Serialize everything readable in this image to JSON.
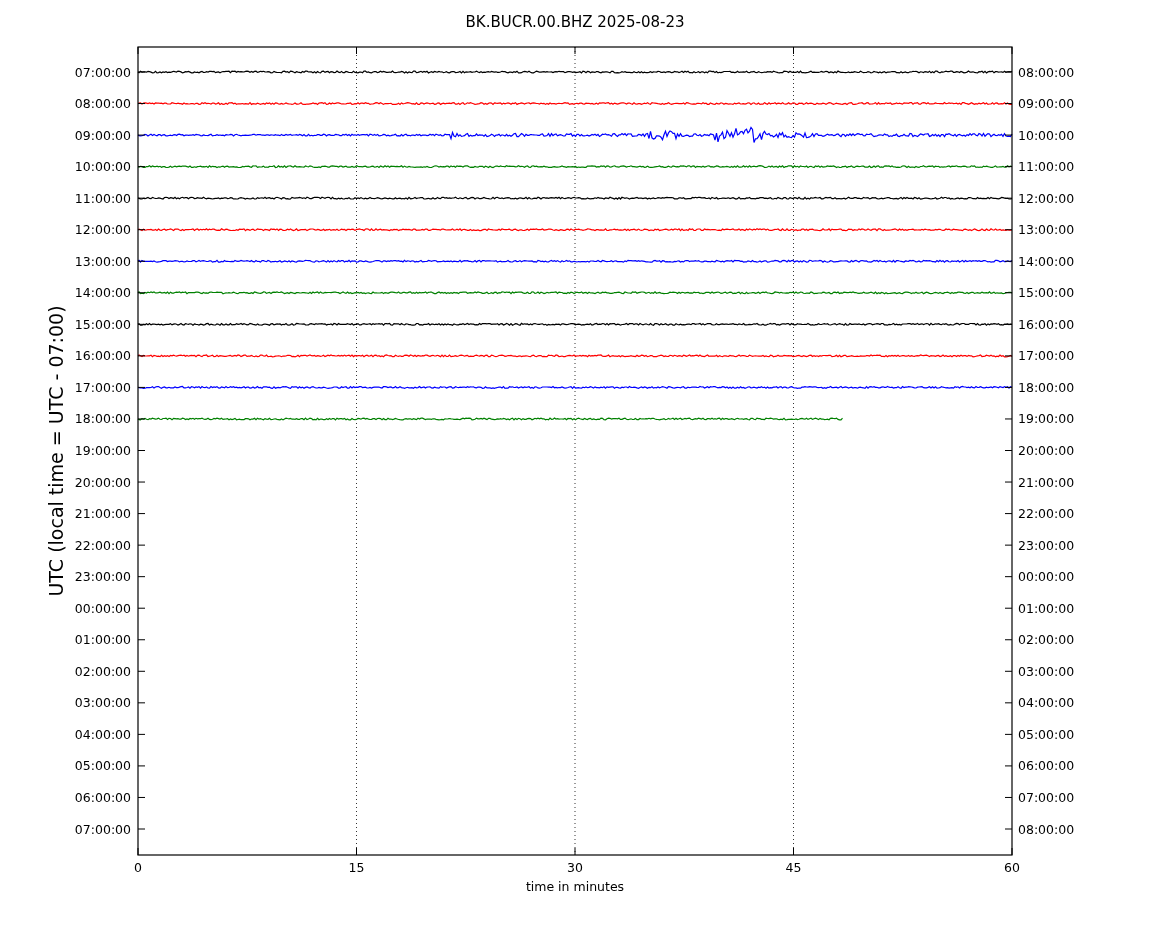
{
  "title": "BK.BUCR.00.BHZ 2025-08-23",
  "chart": {
    "ylabel": "UTC (local time = UTC - 07:00)",
    "xlabel": "time in minutes",
    "xticks": [
      "0",
      "15",
      "30",
      "45",
      "60"
    ],
    "left_labels": [
      "07:00:00",
      "08:00:00",
      "09:00:00",
      "10:00:00",
      "11:00:00",
      "12:00:00",
      "13:00:00",
      "14:00:00",
      "15:00:00",
      "16:00:00",
      "17:00:00",
      "18:00:00",
      "19:00:00",
      "20:00:00",
      "21:00:00",
      "22:00:00",
      "23:00:00",
      "00:00:00",
      "01:00:00",
      "02:00:00",
      "03:00:00",
      "04:00:00",
      "05:00:00",
      "06:00:00",
      "07:00:00"
    ],
    "right_labels": [
      "08:00:00",
      "09:00:00",
      "10:00:00",
      "11:00:00",
      "12:00:00",
      "13:00:00",
      "14:00:00",
      "15:00:00",
      "16:00:00",
      "17:00:00",
      "18:00:00",
      "19:00:00",
      "20:00:00",
      "21:00:00",
      "22:00:00",
      "23:00:00",
      "00:00:00",
      "01:00:00",
      "02:00:00",
      "03:00:00",
      "04:00:00",
      "05:00:00",
      "06:00:00",
      "07:00:00",
      "08:00:00"
    ],
    "traces": [
      {
        "kind": "quiet",
        "color": "#000000",
        "level": 1
      },
      {
        "kind": "quiet",
        "color": "#ff0000",
        "level": 1
      },
      {
        "kind": "event",
        "color": "#0000ff",
        "level": 1
      },
      {
        "kind": "quiet",
        "color": "#008000",
        "level": 1
      },
      {
        "kind": "quiet",
        "color": "#000000",
        "level": 1
      },
      {
        "kind": "quiet",
        "color": "#ff0000",
        "level": 1
      },
      {
        "kind": "quiet",
        "color": "#0000ff",
        "level": 1
      },
      {
        "kind": "quiet",
        "color": "#008000",
        "level": 1
      },
      {
        "kind": "quiet",
        "color": "#000000",
        "level": 1
      },
      {
        "kind": "quiet",
        "color": "#ff0000",
        "level": 1
      },
      {
        "kind": "quiet",
        "color": "#0000ff",
        "level": 1
      },
      {
        "kind": "quiet",
        "color": "#008000",
        "level": 0.807
      }
    ]
  }
}
